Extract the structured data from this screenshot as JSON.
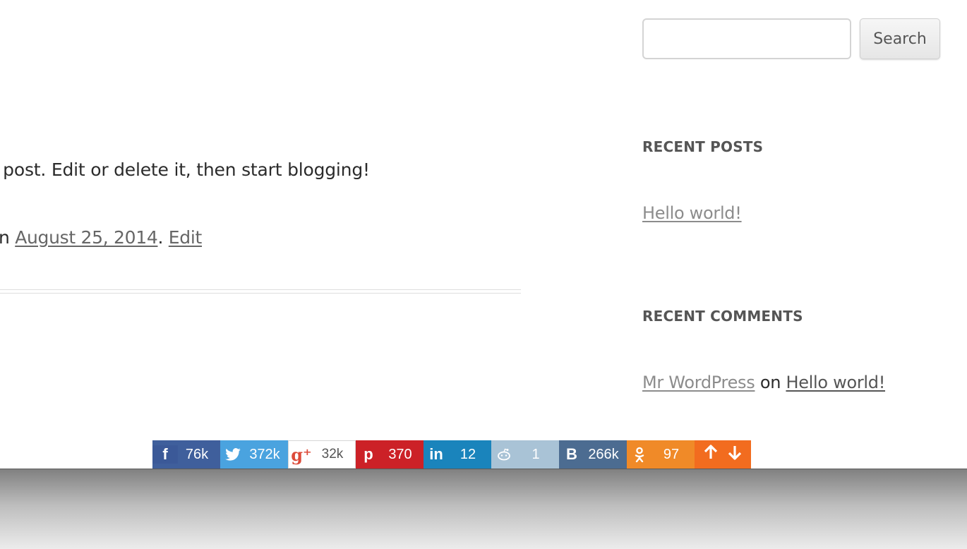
{
  "post": {
    "excerpt": "st post. Edit or delete it, then start blogging!",
    "meta_prefix": "n",
    "date_link": "August 25, 2014",
    "meta_sep": ".",
    "edit_link": "Edit"
  },
  "sidebar": {
    "search": {
      "placeholder": "",
      "button_label": "Search"
    },
    "recent_posts": {
      "title": "RECENT POSTS",
      "items": [
        {
          "label": "Hello world!"
        }
      ]
    },
    "recent_comments": {
      "title": "RECENT COMMENTS",
      "items": [
        {
          "author": "Mr WordPress",
          "connector": "on",
          "post": "Hello world!"
        }
      ]
    }
  },
  "share_bar": {
    "buttons": [
      {
        "network": "facebook",
        "icon": "facebook-icon",
        "glyph": "f",
        "count": "76k",
        "color": "#3f5f9c"
      },
      {
        "network": "twitter",
        "icon": "twitter-icon",
        "glyph": "🐦",
        "count": "372k",
        "color": "#4aa3df"
      },
      {
        "network": "google-plus",
        "icon": "google-plus-icon",
        "glyph": "g⁺",
        "count": "32k",
        "color": "#ffffff"
      },
      {
        "network": "pinterest",
        "icon": "pinterest-icon",
        "glyph": "p",
        "count": "370",
        "color": "#cc2127"
      },
      {
        "network": "linkedin",
        "icon": "linkedin-icon",
        "glyph": "in",
        "count": "12",
        "color": "#1a84bc"
      },
      {
        "network": "reddit",
        "icon": "reddit-icon",
        "glyph": "👽",
        "count": "1",
        "color": "#a9c3d6"
      },
      {
        "network": "vk",
        "icon": "vk-icon",
        "glyph": "B",
        "count": "266k",
        "color": "#4c6c91"
      },
      {
        "network": "odnoklassniki",
        "icon": "odnoklassniki-icon",
        "glyph": "ok",
        "count": "97",
        "color": "#f08a28"
      }
    ],
    "vote": {
      "up_icon": "arrow-up-icon",
      "down_icon": "arrow-down-icon",
      "color": "#f26c1f"
    }
  }
}
